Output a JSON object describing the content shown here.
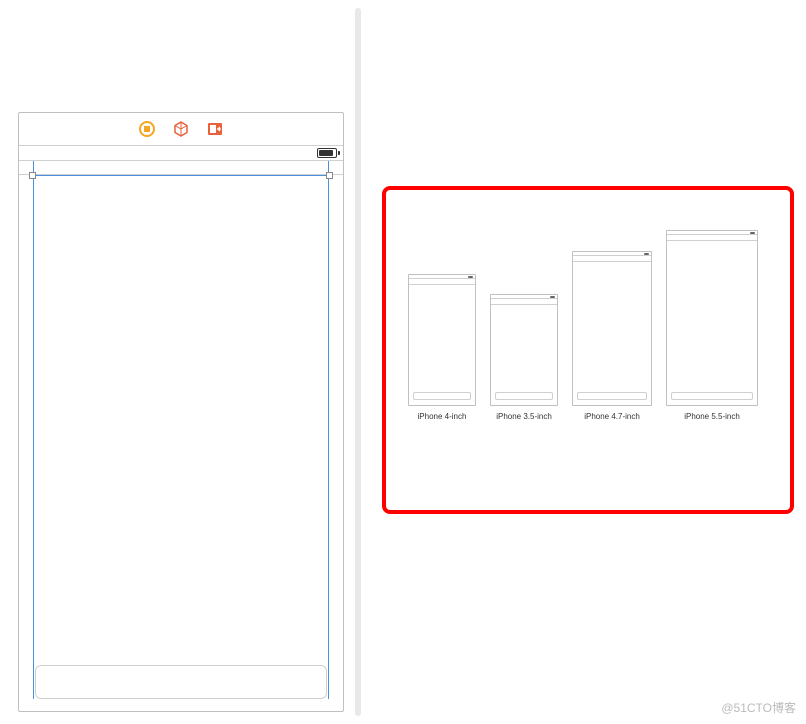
{
  "devices": {
    "iphone_4": "iPhone 4-inch",
    "iphone_35": "iPhone 3.5-inch",
    "iphone_47": "iPhone 4.7-inch",
    "iphone_55": "iPhone 5.5-inch"
  },
  "toolbar": {
    "icons": {
      "sizeclass": "sizeclass-icon",
      "object": "object-icon",
      "embedded": "embedded-icon"
    }
  },
  "colors": {
    "guide": "#4a90e2",
    "accent_yellow": "#f5a623",
    "accent_orange": "#e8603c",
    "border_red": "#ff0000"
  },
  "watermark": "@51CTO博客"
}
